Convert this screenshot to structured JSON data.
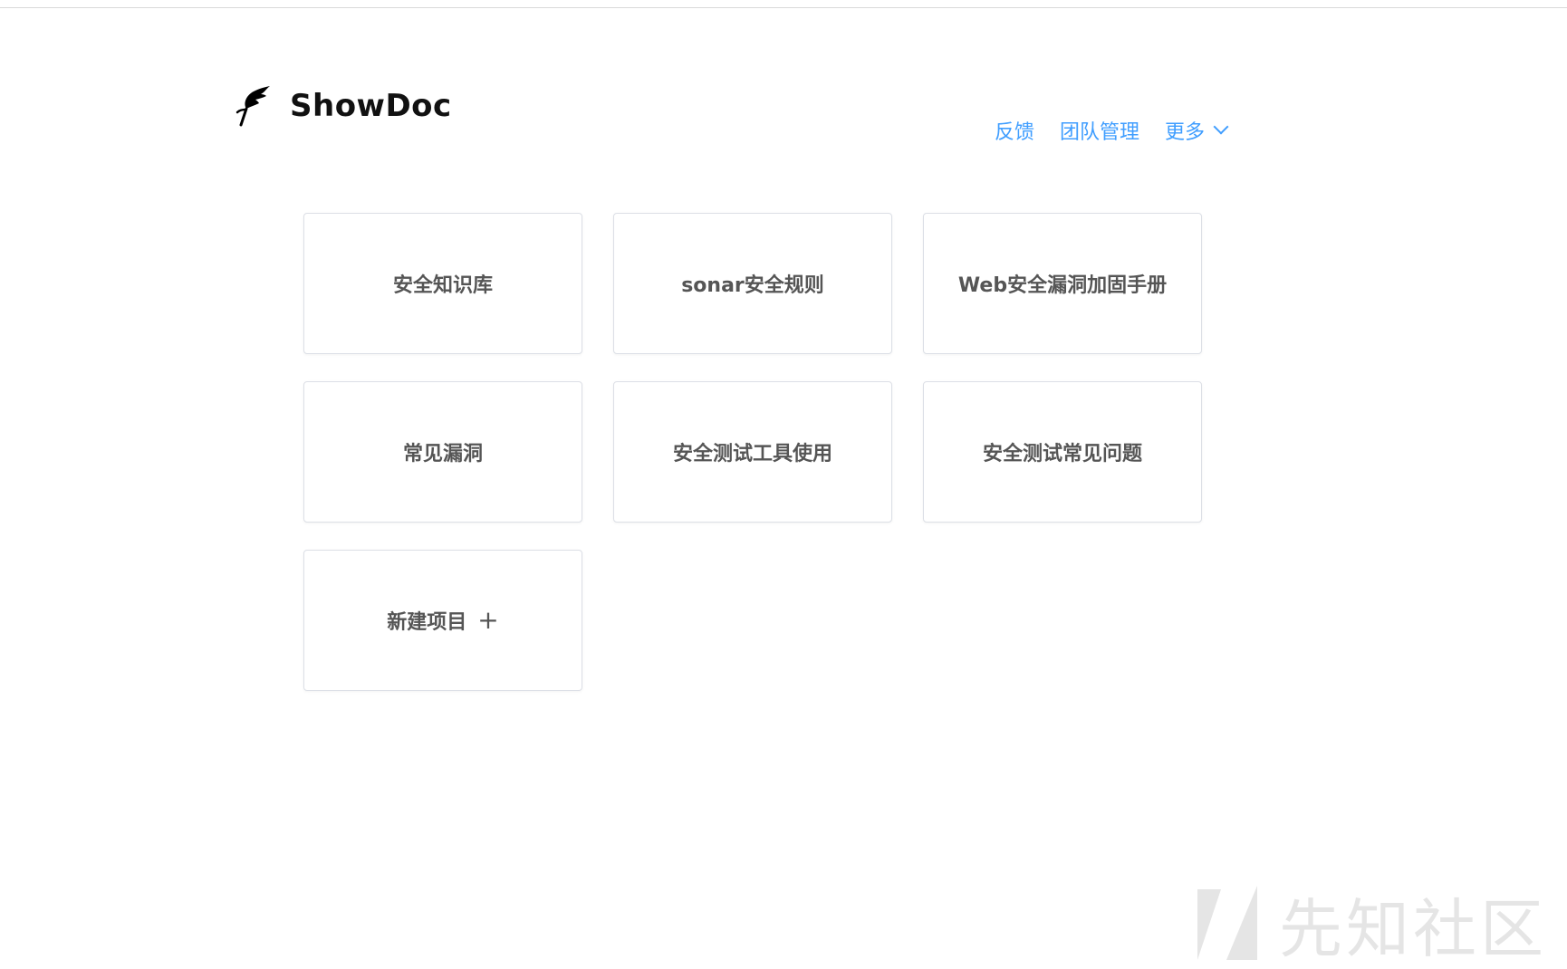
{
  "header": {
    "brand": "ShowDoc",
    "nav": {
      "feedback": "反馈",
      "team": "团队管理",
      "more": "更多"
    }
  },
  "projects": [
    {
      "label": "安全知识库"
    },
    {
      "label": "sonar安全规则"
    },
    {
      "label": "Web安全漏洞加固手册"
    },
    {
      "label": "常见漏洞"
    },
    {
      "label": "安全测试工具使用"
    },
    {
      "label": "安全测试常见问题"
    }
  ],
  "new_project": {
    "label": "新建项目",
    "icon": "plus-icon"
  },
  "watermark": {
    "text": "先知社区"
  },
  "colors": {
    "link": "#409eff",
    "card_border": "#dcdfe6",
    "card_text": "#555555"
  }
}
